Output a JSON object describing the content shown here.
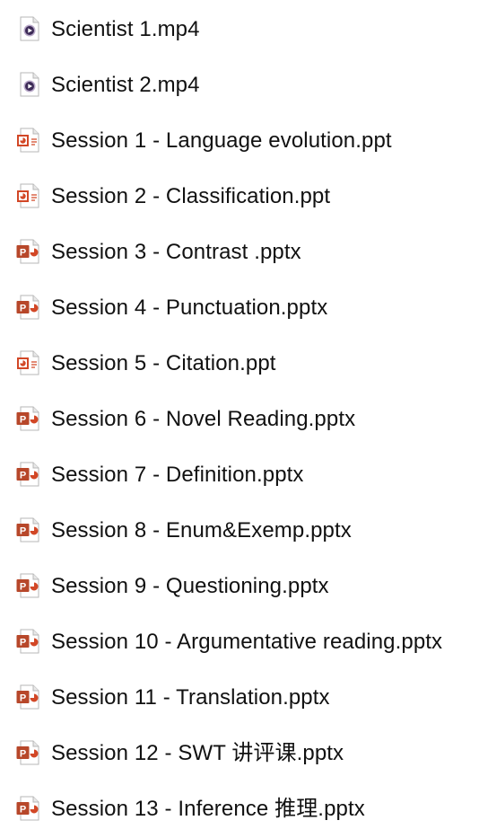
{
  "files": [
    {
      "name": "Scientist 1.mp4",
      "type": "video",
      "icon": "video-file-icon"
    },
    {
      "name": "Scientist 2.mp4",
      "type": "video",
      "icon": "video-file-icon"
    },
    {
      "name": "Session 1 - Language evolution.ppt",
      "type": "ppt",
      "icon": "ppt-file-icon"
    },
    {
      "name": "Session 2 - Classification.ppt",
      "type": "ppt",
      "icon": "ppt-file-icon"
    },
    {
      "name": "Session 3 - Contrast .pptx",
      "type": "pptx",
      "icon": "pptx-file-icon"
    },
    {
      "name": "Session 4 - Punctuation.pptx",
      "type": "pptx",
      "icon": "pptx-file-icon"
    },
    {
      "name": "Session 5 - Citation.ppt",
      "type": "ppt",
      "icon": "ppt-file-icon"
    },
    {
      "name": "Session 6 - Novel Reading.pptx",
      "type": "pptx",
      "icon": "pptx-file-icon"
    },
    {
      "name": "Session 7 - Definition.pptx",
      "type": "pptx",
      "icon": "pptx-file-icon"
    },
    {
      "name": "Session 8 - Enum&Exemp.pptx",
      "type": "pptx",
      "icon": "pptx-file-icon"
    },
    {
      "name": "Session 9 - Questioning.pptx",
      "type": "pptx",
      "icon": "pptx-file-icon"
    },
    {
      "name": "Session 10 - Argumentative reading.pptx",
      "type": "pptx",
      "icon": "pptx-file-icon"
    },
    {
      "name": "Session 11 - Translation.pptx",
      "type": "pptx",
      "icon": "pptx-file-icon"
    },
    {
      "name": "Session 12 - SWT 讲评课.pptx",
      "type": "pptx",
      "icon": "pptx-file-icon"
    },
    {
      "name": "Session 13 - Inference 推理.pptx",
      "type": "pptx",
      "icon": "pptx-file-icon"
    }
  ],
  "colors": {
    "powerpoint_red": "#d24726",
    "powerpoint_dark": "#b7472a",
    "video_dark": "#3d2b57",
    "video_ring": "#b8a8c8",
    "page_fill": "#ffffff",
    "page_border": "#b7b7b7",
    "text": "#111111"
  }
}
